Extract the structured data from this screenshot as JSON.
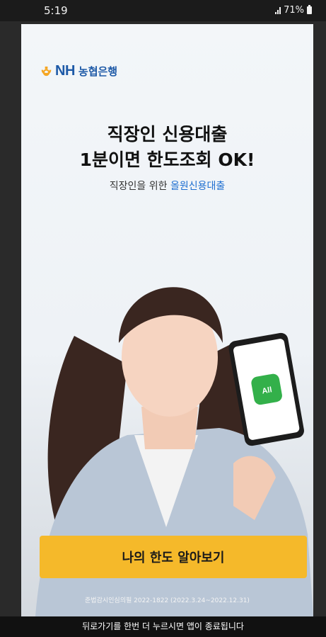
{
  "status_bar": {
    "time": "5:19",
    "battery_percent": "71%"
  },
  "logo": {
    "brand_en": "NH",
    "brand_kr": "농협은행"
  },
  "headline": {
    "line1": "직장인 신용대출",
    "line2": "1분이면 한도조회 OK!",
    "sub_prefix": "직장인을 위한 ",
    "sub_highlight": "올원신용대출"
  },
  "phone_app": {
    "label": "All"
  },
  "cta": {
    "label": "나의 한도 알아보기"
  },
  "legal": {
    "text": "준법감시인심의필 2022-1822 (2022.3.24~2022.12.31)"
  },
  "toast": {
    "text": "뒤로가기를 한번 더 누르시면 앱이 종료됩니다"
  },
  "colors": {
    "accent": "#f5b92a",
    "brand_blue": "#1e5aa7",
    "highlight": "#1f6fd1"
  }
}
